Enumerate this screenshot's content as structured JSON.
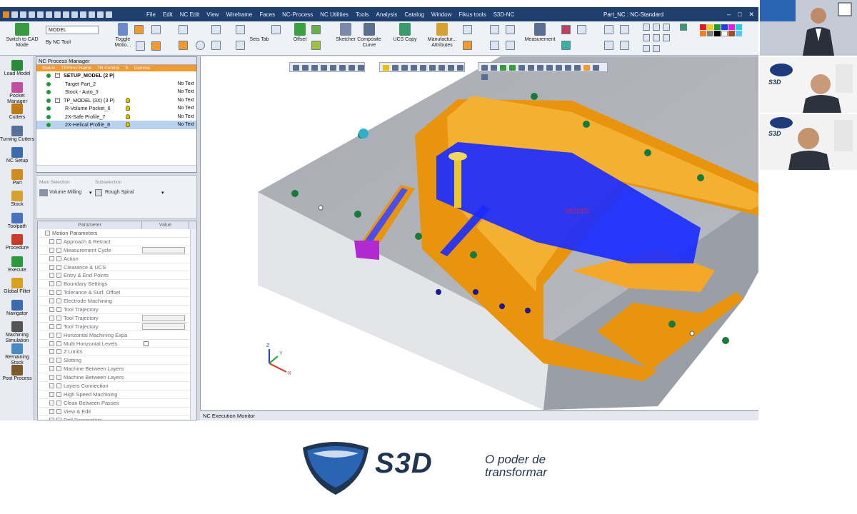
{
  "window": {
    "title": "Part_NC : NC-Standard",
    "menu": [
      "File",
      "Edit",
      "NC Edit",
      "View",
      "Wireframe",
      "Faces",
      "NC-Process",
      "NC Utilities",
      "Tools",
      "Analysis",
      "Catalog",
      "Window",
      "Fikus tools",
      "S3D-NC"
    ],
    "min": "–",
    "max": "□",
    "close": "✕"
  },
  "ribbon": {
    "switch_cad": "Switch to CAD Mode",
    "model_select": "MODEL",
    "by_nc_tool": "By NC Tool",
    "toggle_motion": "Toggle Motio...",
    "sets_tab": "Sets Tab",
    "offset": "Offset",
    "sketcher": "Sketcher",
    "composite_curve": "Composite Curve",
    "ucs_copy": "UCS Copy",
    "manufacturing_attributes": "Manufactur... Attributes",
    "measurement": "Measurement"
  },
  "left_toolbar": [
    {
      "label": "Load Model",
      "icon": "load-model-icon",
      "color": "#2a8a3a"
    },
    {
      "label": "Pocket Manager",
      "icon": "pocket-manager-icon",
      "color": "#c04fa0"
    },
    {
      "label": "Cutters",
      "icon": "cutters-icon",
      "color": "#c07a1a"
    },
    {
      "label": "Turning Cutters",
      "icon": "turning-cutters-icon",
      "color": "#5a6e9a"
    },
    {
      "label": "NC Setup",
      "icon": "nc-setup-icon",
      "color": "#3a6ab0"
    },
    {
      "label": "Part",
      "icon": "part-icon",
      "color": "#d08a20"
    },
    {
      "label": "Stock",
      "icon": "stock-icon",
      "color": "#d8a030"
    },
    {
      "label": "Toolpath",
      "icon": "toolpath-icon",
      "color": "#4a70c0"
    },
    {
      "label": "Procedure",
      "icon": "procedure-icon",
      "color": "#c83a2a"
    },
    {
      "label": "Execute",
      "icon": "execute-icon",
      "color": "#2a9a3a"
    },
    {
      "label": "Global Filter",
      "icon": "global-filter-icon",
      "color": "#d8a020"
    },
    {
      "label": "Navigator",
      "icon": "navigator-icon",
      "color": "#3a6ab0"
    },
    {
      "label": "Machining Simulation",
      "icon": "machining-simulation-icon",
      "color": "#555"
    },
    {
      "label": "Remaining Stock",
      "icon": "remaining-stock-icon",
      "color": "#4a8ac0"
    },
    {
      "label": "Post Process",
      "icon": "post-process-icon",
      "color": "#7a5a2a"
    }
  ],
  "nc_process_manager": {
    "title": "NC Process Manager",
    "columns": [
      "Status",
      "TP/Proc.Name",
      "Tilt Control",
      "S",
      "Comme"
    ],
    "rows": [
      {
        "name": "SETUP_MODEL (2 P)",
        "indent": 1,
        "bold": true,
        "note": "",
        "bulb": false,
        "expand": true
      },
      {
        "name": "Target Part_2",
        "indent": 2,
        "bold": false,
        "note": "No Text",
        "bulb": false,
        "expand": false
      },
      {
        "name": "Stock - Auto_3",
        "indent": 2,
        "bold": false,
        "note": "No Text",
        "bulb": false,
        "expand": false
      },
      {
        "name": "TP_MODEL (3X) (3 P)",
        "indent": 1,
        "bold": false,
        "note": "No Text",
        "bulb": true,
        "expand": true
      },
      {
        "name": "R-Volume Pocket_6",
        "indent": 2,
        "bold": false,
        "note": "No Text",
        "bulb": true,
        "expand": false
      },
      {
        "name": "2X-Safe Profile_7",
        "indent": 2,
        "bold": false,
        "note": "No Text",
        "bulb": true,
        "expand": false
      },
      {
        "name": "2X-Helical Profile_8",
        "indent": 2,
        "bold": false,
        "note": "No Text",
        "bulb": true,
        "expand": false,
        "selected": true
      }
    ]
  },
  "selection": {
    "main_label": "Main Selection",
    "main_value": "Volume Milling",
    "sub_label": "Subselection",
    "sub_value": "Rough Spiral"
  },
  "parameters": {
    "col_param": "Parameter",
    "col_value": "Value",
    "rows": [
      {
        "name": "Motion Parameters",
        "group": true
      },
      {
        "name": "Approach & Retract"
      },
      {
        "name": "Measurement Cycle",
        "vbox": true
      },
      {
        "name": "Action"
      },
      {
        "name": "Clearance & UCS"
      },
      {
        "name": "Entry & End Points"
      },
      {
        "name": "Boundary Settings"
      },
      {
        "name": "Tolerance & Surf. Offset"
      },
      {
        "name": "Electrode Machining"
      },
      {
        "name": "Tool Trajectory"
      },
      {
        "name": "Tool Trajectory",
        "vbox": true
      },
      {
        "name": "Tool Trajectory",
        "vbox": true
      },
      {
        "name": "Horizontal Machining Expa"
      },
      {
        "name": "Multi Horizontal Levels",
        "check": true
      },
      {
        "name": "Z Limits"
      },
      {
        "name": "Slotting"
      },
      {
        "name": "Machine Between Layers"
      },
      {
        "name": "Machine Between Layers"
      },
      {
        "name": "Layers Connection"
      },
      {
        "name": "High Speed Machining"
      },
      {
        "name": "Clean Between Passes"
      },
      {
        "name": "View & Edit"
      },
      {
        "name": "Drill Parameters"
      }
    ]
  },
  "viewport": {
    "toolpath_label": "MODEL",
    "axes": {
      "x": "X",
      "y": "Y",
      "z": "Z"
    }
  },
  "status_bar": "NC Execution Monitor",
  "brand": {
    "name": "S3D",
    "tagline_1": "O poder de",
    "tagline_2": "transformar",
    "colors": {
      "navy": "#1f3552",
      "blue": "#2c64b4",
      "orange": "#f39a2e",
      "toolpath": "#1a2cff"
    }
  }
}
